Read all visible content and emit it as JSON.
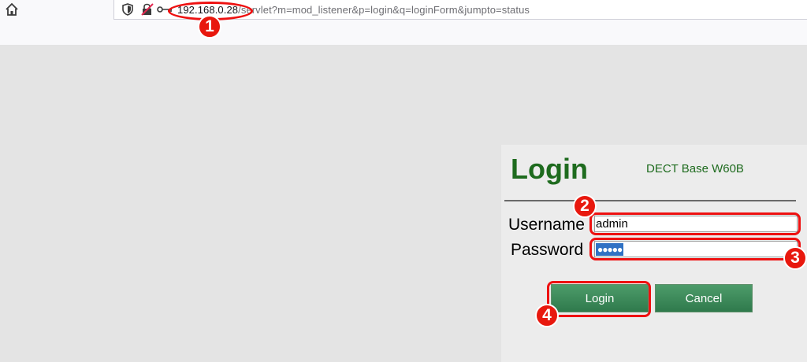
{
  "browser": {
    "url_host": "192.168.0.28",
    "url_path": "/servlet?m=mod_listener&p=login&q=loginForm&jumpto=status"
  },
  "login_panel": {
    "title": "Login",
    "device_model": "DECT Base W60B",
    "username_label": "Username",
    "password_label": "Password",
    "username_value": "admin",
    "password_mask": "●●●●●",
    "login_button": "Login",
    "cancel_button": "Cancel"
  },
  "annotations": {
    "markers": [
      "1",
      "2",
      "3",
      "4"
    ],
    "color": "#e8180e"
  },
  "colors": {
    "brand_green": "#1e6b1e",
    "button_green": "#3a8a58",
    "page_background": "#e4e4e4"
  }
}
